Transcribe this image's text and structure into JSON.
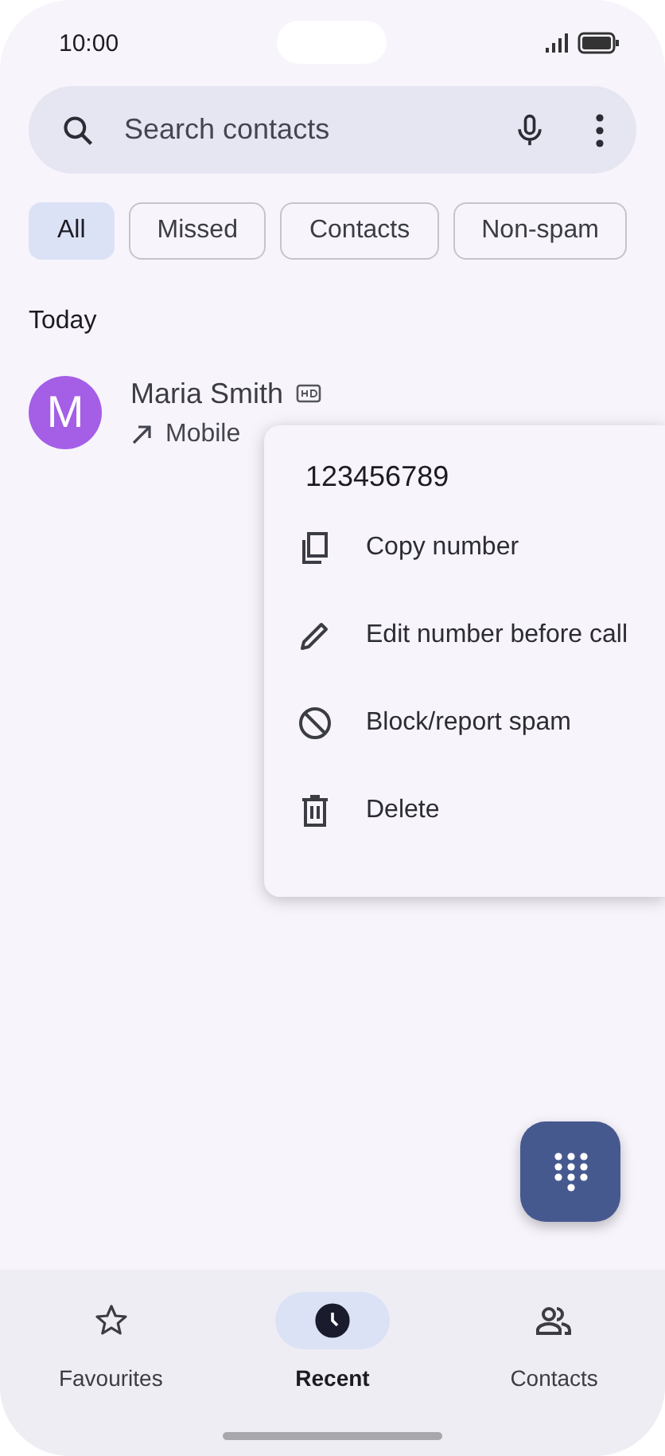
{
  "status_bar": {
    "time": "10:00"
  },
  "search": {
    "placeholder": "Search contacts"
  },
  "filters": [
    {
      "label": "All",
      "selected": true
    },
    {
      "label": "Missed",
      "selected": false
    },
    {
      "label": "Contacts",
      "selected": false
    },
    {
      "label": "Non-spam",
      "selected": false
    }
  ],
  "section": "Today",
  "calls": [
    {
      "initial": "M",
      "name": "Maria Smith",
      "hd": true,
      "type": "Mobile",
      "color": "#a55ee6"
    }
  ],
  "menu": {
    "number": "123456789",
    "items": [
      {
        "kind": "copy",
        "label": "Copy number"
      },
      {
        "kind": "edit",
        "label": "Edit number before call"
      },
      {
        "kind": "block",
        "label": "Block/report spam"
      },
      {
        "kind": "delete",
        "label": "Delete"
      }
    ]
  },
  "nav": [
    {
      "kind": "star",
      "label": "Favourites",
      "selected": false
    },
    {
      "kind": "clock",
      "label": "Recent",
      "selected": true
    },
    {
      "kind": "people",
      "label": "Contacts",
      "selected": false
    }
  ]
}
